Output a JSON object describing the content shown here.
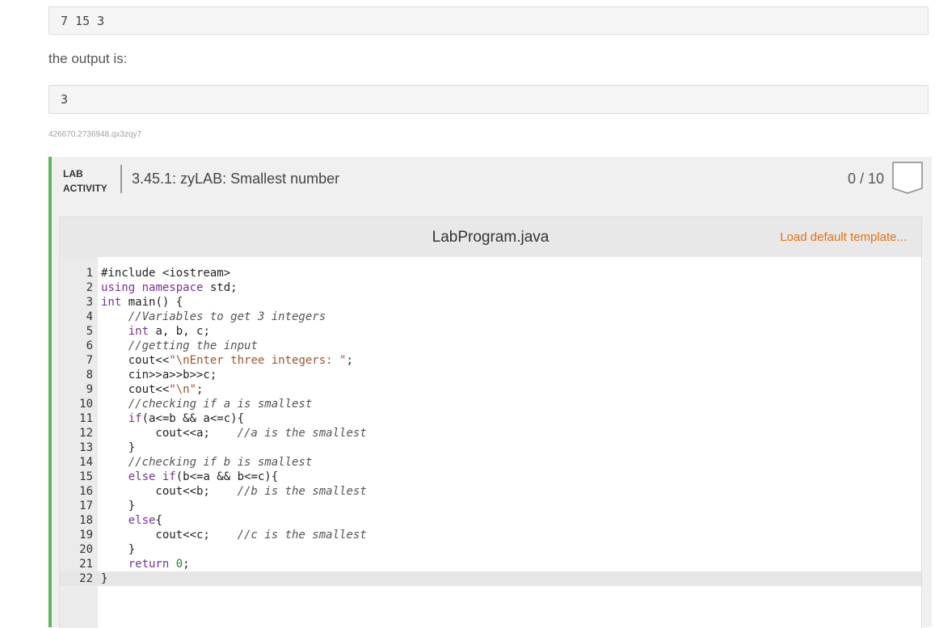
{
  "sample": {
    "input_value": "7 15 3",
    "output_label": "the output is:",
    "output_value": "3",
    "lab_id": "426670.2736948.qx3zqy7"
  },
  "lab": {
    "tag_line1": "LAB",
    "tag_line2": "ACTIVITY",
    "title": "3.45.1: zyLAB: Smallest number",
    "score": "0 / 10",
    "accent_color": "#5cb85c"
  },
  "editor": {
    "file_name": "LabProgram.java",
    "load_template_label": "Load default template...",
    "lines": [
      "#include <iostream>",
      "using namespace std;",
      "int main() {",
      "    //Variables to get 3 integers",
      "    int a, b, c;",
      "    //getting the input",
      "    cout<<\"\\nEnter three integers: \";",
      "    cin>>a>>b>>c;",
      "    cout<<\"\\n\";",
      "    //checking if a is smallest",
      "    if(a<=b && a<=c){",
      "        cout<<a;    //a is the smallest",
      "    }",
      "    //checking if b is smallest",
      "    else if(b<=a && b<=c){",
      "        cout<<b;    //b is the smallest",
      "    }",
      "    else{",
      "        cout<<c;    //c is the smallest",
      "    }",
      "    return 0;",
      "}"
    ],
    "active_line": 22
  }
}
